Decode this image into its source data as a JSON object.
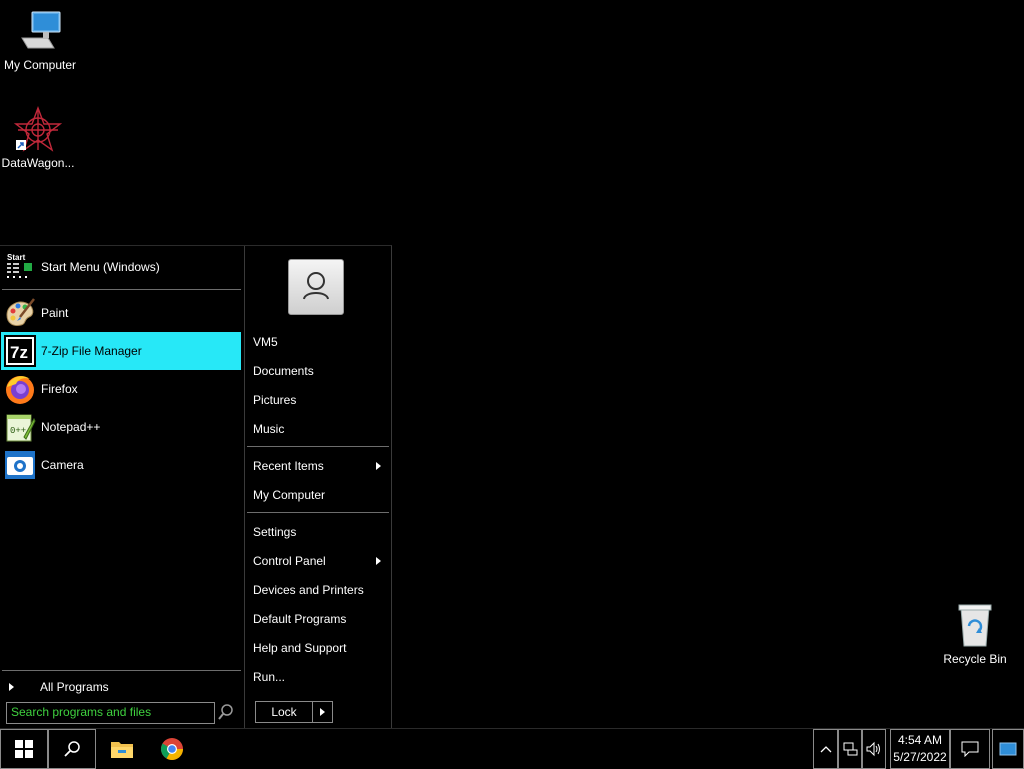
{
  "desktop": {
    "icons": [
      {
        "label": "My Computer",
        "icon": "computer-icon"
      },
      {
        "label": "DataWagon...",
        "icon": "datawagon-shortcut-icon"
      },
      {
        "label": "Recycle Bin",
        "icon": "recycle-bin-icon"
      }
    ]
  },
  "start_menu": {
    "header": {
      "label": "Start Menu (Windows)",
      "icon": "start-menu-icon",
      "icon_text": "Start"
    },
    "programs": [
      {
        "label": "Paint",
        "icon": "paint-icon"
      },
      {
        "label": "7-Zip File Manager",
        "icon": "7zip-icon",
        "selected": true,
        "icon_text": "7z"
      },
      {
        "label": "Firefox",
        "icon": "firefox-icon"
      },
      {
        "label": "Notepad++",
        "icon": "notepadpp-icon"
      },
      {
        "label": "Camera",
        "icon": "camera-icon"
      }
    ],
    "all_programs": "All Programs",
    "search": {
      "placeholder": "Search programs and files"
    },
    "right": {
      "user_icon": "user-avatar-icon",
      "items_group1": [
        "VM5",
        "Documents",
        "Pictures",
        "Music"
      ],
      "items_group2": [
        {
          "label": "Recent Items",
          "submenu": true
        },
        {
          "label": "My Computer",
          "submenu": false
        }
      ],
      "items_group3": [
        {
          "label": "Settings",
          "submenu": false
        },
        {
          "label": "Control Panel",
          "submenu": true
        },
        {
          "label": "Devices and Printers",
          "submenu": false
        },
        {
          "label": "Default Programs",
          "submenu": false
        },
        {
          "label": "Help and Support",
          "submenu": false
        },
        {
          "label": "Run...",
          "submenu": false
        }
      ],
      "lock_label": "Lock"
    }
  },
  "taskbar": {
    "pinned": [
      "start-button",
      "search-button",
      "file-explorer",
      "chrome"
    ],
    "clock": {
      "time": "4:54 AM",
      "date": "5/27/2022"
    }
  },
  "colors": {
    "selection": "#27e8f7",
    "search_text": "#3fd13f",
    "background": "#000000"
  }
}
